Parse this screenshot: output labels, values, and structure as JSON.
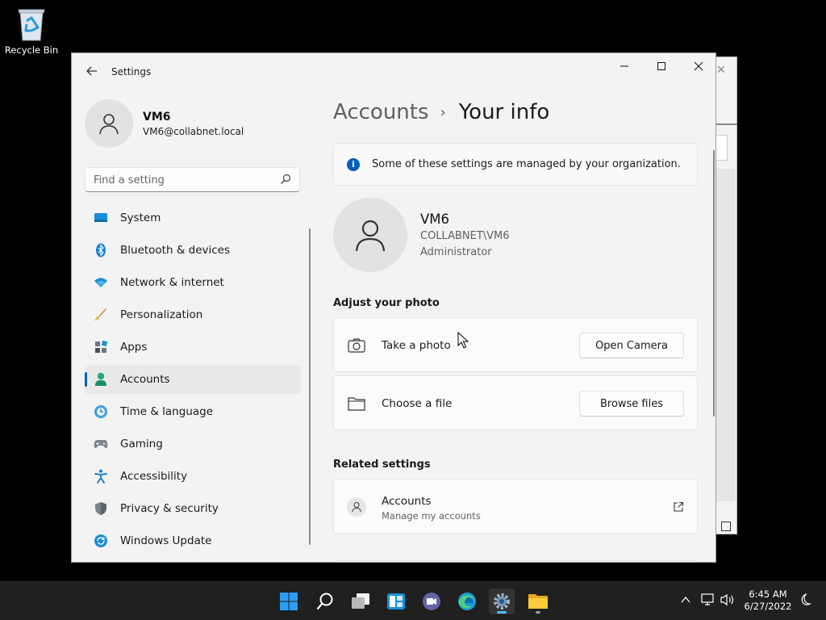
{
  "desktop": {
    "recycle_bin_label": "Recycle Bin"
  },
  "window": {
    "app_title": "Settings",
    "controls": {
      "minimize": "—",
      "maximize": "☐",
      "close": "✕"
    }
  },
  "profile": {
    "name": "VM6",
    "email": "VM6@collabnet.local"
  },
  "search": {
    "placeholder": "Find a setting"
  },
  "nav": {
    "items": [
      {
        "label": "System",
        "icon": "system-icon"
      },
      {
        "label": "Bluetooth & devices",
        "icon": "bluetooth-icon"
      },
      {
        "label": "Network & internet",
        "icon": "wifi-icon"
      },
      {
        "label": "Personalization",
        "icon": "brush-icon"
      },
      {
        "label": "Apps",
        "icon": "apps-icon"
      },
      {
        "label": "Accounts",
        "icon": "accounts-icon",
        "active": true
      },
      {
        "label": "Time & language",
        "icon": "clock-globe-icon"
      },
      {
        "label": "Gaming",
        "icon": "gamepad-icon"
      },
      {
        "label": "Accessibility",
        "icon": "accessibility-icon"
      },
      {
        "label": "Privacy & security",
        "icon": "shield-icon"
      },
      {
        "label": "Windows Update",
        "icon": "update-icon"
      }
    ]
  },
  "breadcrumb": {
    "parent": "Accounts",
    "separator": "›",
    "current": "Your info"
  },
  "notice": {
    "text": "Some of these settings are managed by your organization."
  },
  "user": {
    "name": "VM6",
    "domain": "COLLABNET\\VM6",
    "role": "Administrator"
  },
  "photo_section": {
    "heading": "Adjust your photo",
    "take_photo": {
      "label": "Take a photo",
      "button": "Open Camera"
    },
    "choose_file": {
      "label": "Choose a file",
      "button": "Browse files"
    }
  },
  "related": {
    "heading": "Related settings",
    "accounts": {
      "title": "Accounts",
      "subtitle": "Manage my accounts"
    }
  },
  "taskbar": {
    "clock_time": "6:45 AM",
    "clock_date": "6/27/2022"
  },
  "colors": {
    "accent": "#005fb8",
    "taskbar_indicator": "#4cc2ff"
  }
}
